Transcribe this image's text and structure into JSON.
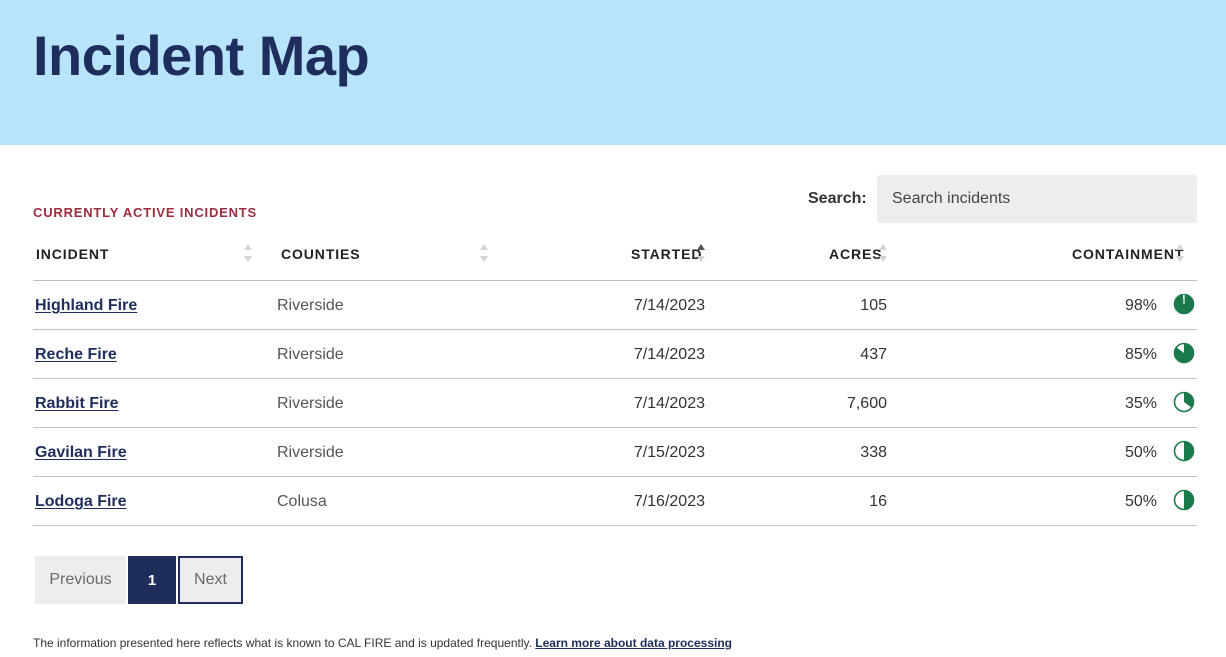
{
  "header": {
    "title": "Incident Map"
  },
  "section": {
    "label": "CURRENTLY ACTIVE INCIDENTS"
  },
  "search": {
    "label": "Search:",
    "placeholder": "Search incidents",
    "value": ""
  },
  "table": {
    "columns": {
      "incident": "INCIDENT",
      "counties": "COUNTIES",
      "started": "STARTED",
      "acres": "ACRES",
      "containment": "CONTAINMENT"
    },
    "sorted_by": "started",
    "sort_direction": "ascending",
    "rows": [
      {
        "incident": "Highland Fire",
        "county": "Riverside",
        "started": "7/14/2023",
        "acres": "105",
        "containment": "98%",
        "containment_value": 98
      },
      {
        "incident": "Reche Fire",
        "county": "Riverside",
        "started": "7/14/2023",
        "acres": "437",
        "containment": "85%",
        "containment_value": 85
      },
      {
        "incident": "Rabbit Fire",
        "county": "Riverside",
        "started": "7/14/2023",
        "acres": "7,600",
        "containment": "35%",
        "containment_value": 35
      },
      {
        "incident": "Gavilan Fire",
        "county": "Riverside",
        "started": "7/15/2023",
        "acres": "338",
        "containment": "50%",
        "containment_value": 50
      },
      {
        "incident": "Lodoga Fire",
        "county": "Colusa",
        "started": "7/16/2023",
        "acres": "16",
        "containment": "50%",
        "containment_value": 50
      }
    ]
  },
  "pagination": {
    "previous": "Previous",
    "current_page": "1",
    "next": "Next"
  },
  "footer": {
    "text": "The information presented here reflects what is known to CAL FIRE and is updated frequently.",
    "link": "Learn more about data processing"
  },
  "colors": {
    "hero_bg": "#b8e4fb",
    "title": "#1f2d5c",
    "section_label": "#9b2d3f",
    "containment_green": "#1a7a4c"
  },
  "icons": {
    "containment": "containment-pie-icon",
    "sort": "sort-arrows-icon"
  }
}
